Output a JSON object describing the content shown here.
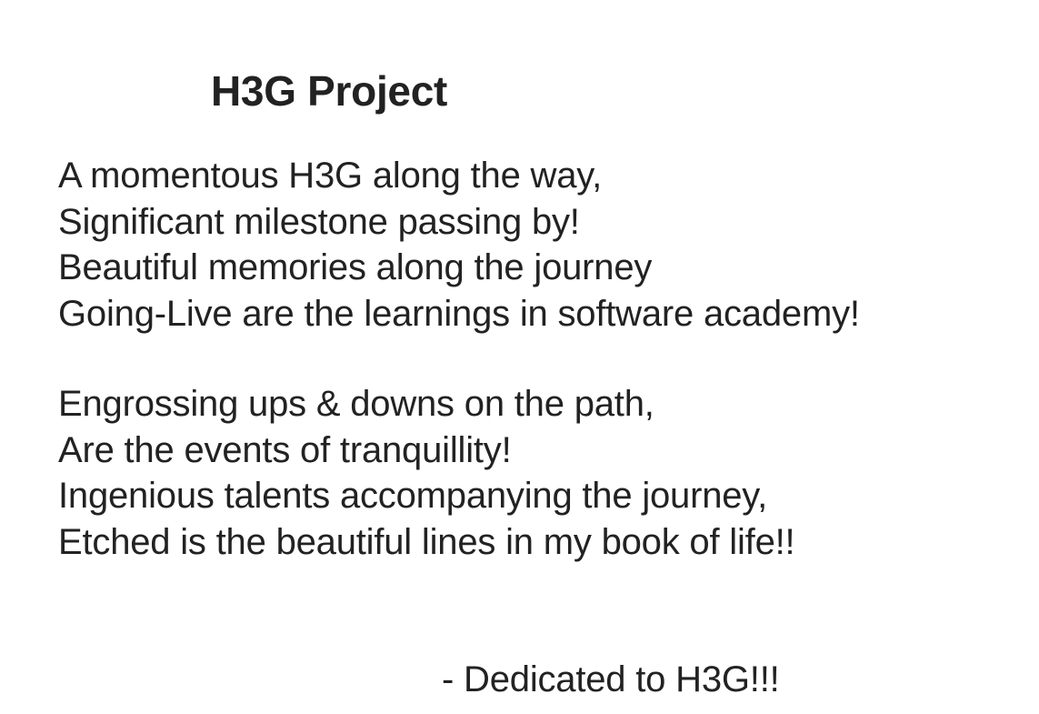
{
  "document": {
    "title": "H3G Project",
    "stanzas": [
      {
        "lines": [
          "A momentous H3G along the way,",
          "Significant milestone passing by!",
          "Beautiful memories along the journey",
          "Going-Live are the learnings in software academy!"
        ]
      },
      {
        "lines": [
          "Engrossing ups & downs on the path,",
          "Are the events of tranquillity!",
          "Ingenious talents accompanying the journey,",
          "Etched is the beautiful lines in my book of life!!"
        ]
      }
    ],
    "dedication": "- Dedicated to H3G!!!"
  }
}
